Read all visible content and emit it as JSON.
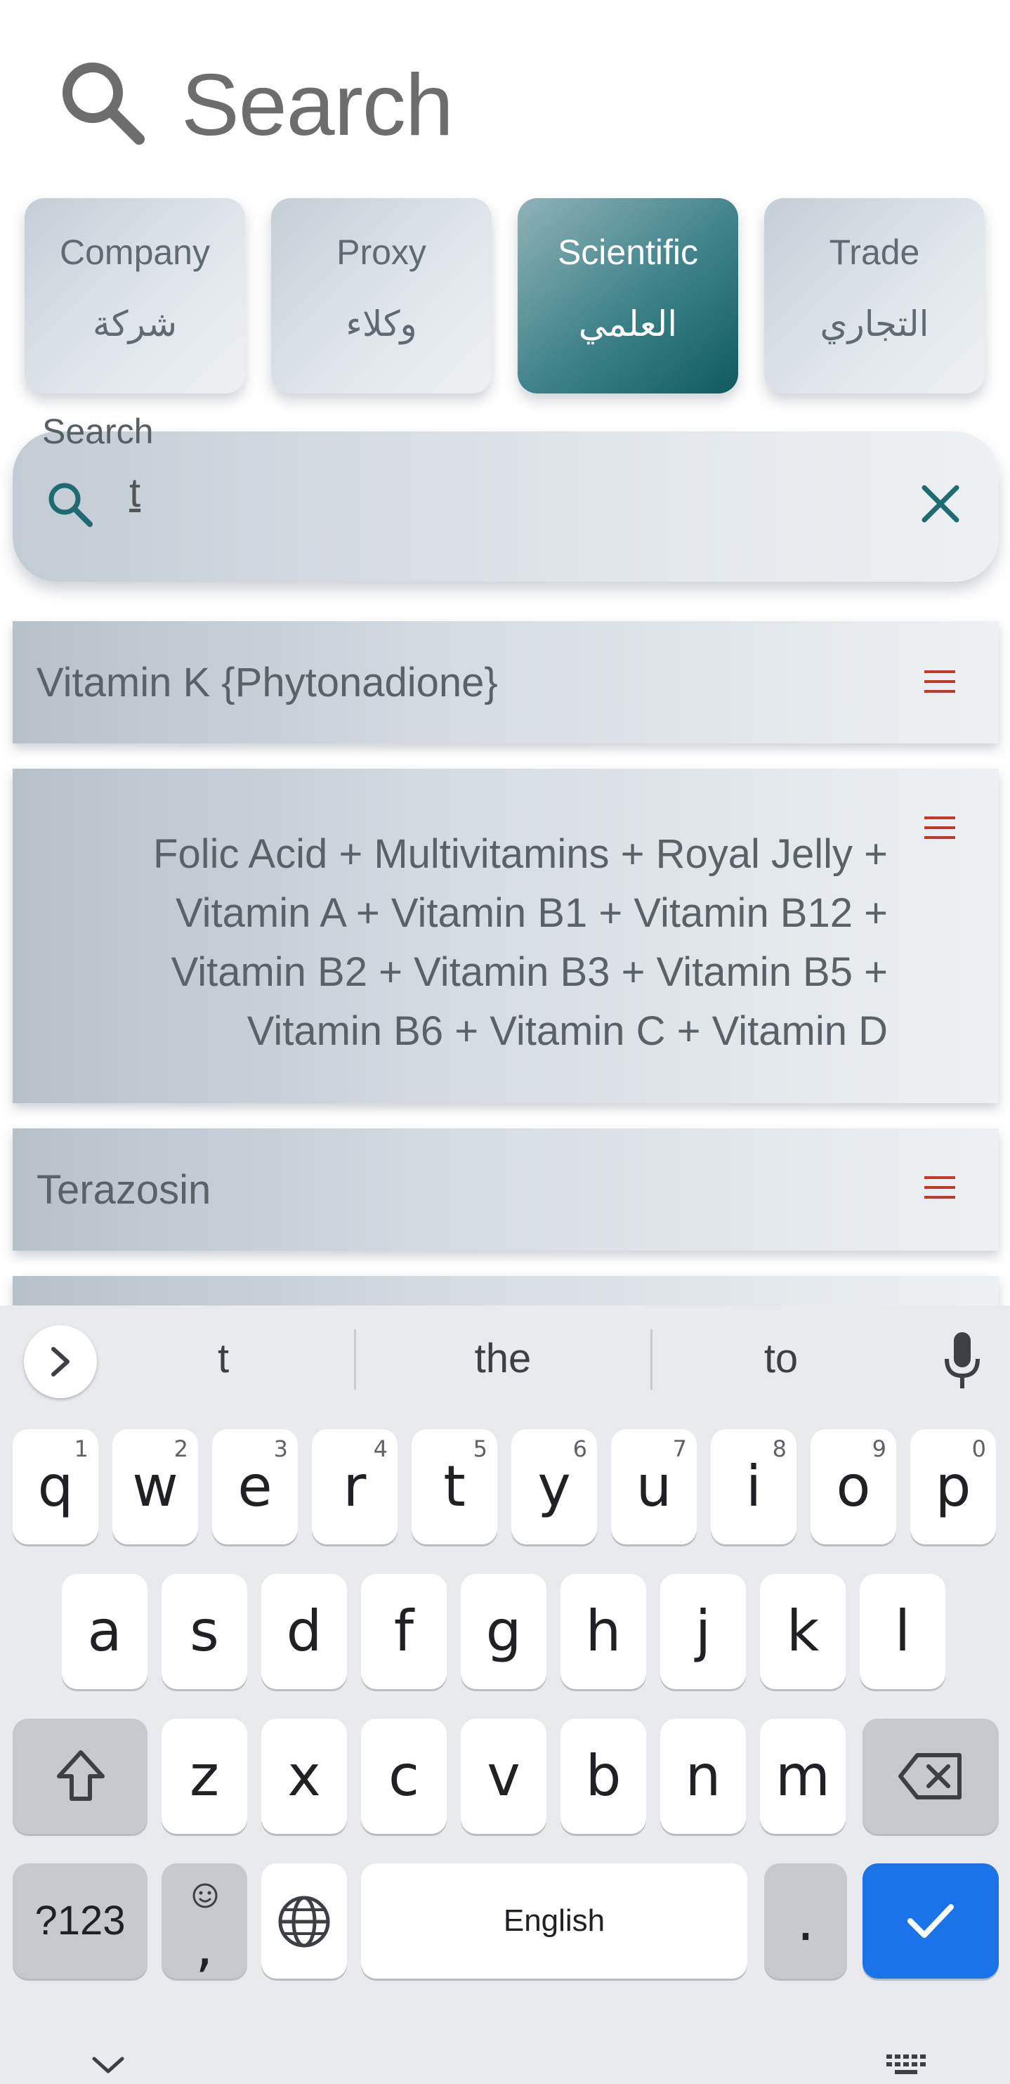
{
  "header": {
    "title": "Search",
    "icon": "search-icon"
  },
  "tabs": [
    {
      "en": "Company",
      "ar": "شركة",
      "active": false
    },
    {
      "en": "Proxy",
      "ar": "وكلاء",
      "active": false
    },
    {
      "en": "Scientific",
      "ar": "العلمي",
      "active": true
    },
    {
      "en": "Trade",
      "ar": "التجاري",
      "active": false
    }
  ],
  "search": {
    "label": "Search",
    "value": "t",
    "clear_icon": "close-icon"
  },
  "results": [
    {
      "title": "Vitamin K {Phytonadione}"
    },
    {
      "lines": [
        "Folic Acid + Multivitamins + Royal Jelly +",
        "Vitamin A + Vitamin B1 + Vitamin B12 +",
        "Vitamin B2 + Vitamin B3 + Vitamin B5 +",
        "Vitamin B6 + Vitamin C + Vitamin D"
      ]
    },
    {
      "title": "Terazosin"
    }
  ],
  "keyboard": {
    "suggestions": [
      "t",
      "the",
      "to"
    ],
    "row1": [
      {
        "k": "q",
        "h": "1"
      },
      {
        "k": "w",
        "h": "2"
      },
      {
        "k": "e",
        "h": "3"
      },
      {
        "k": "r",
        "h": "4"
      },
      {
        "k": "t",
        "h": "5"
      },
      {
        "k": "y",
        "h": "6"
      },
      {
        "k": "u",
        "h": "7"
      },
      {
        "k": "i",
        "h": "8"
      },
      {
        "k": "o",
        "h": "9"
      },
      {
        "k": "p",
        "h": "0"
      }
    ],
    "row2": [
      "a",
      "s",
      "d",
      "f",
      "g",
      "h",
      "j",
      "k",
      "l"
    ],
    "row3": [
      "z",
      "x",
      "c",
      "v",
      "b",
      "n",
      "m"
    ],
    "symbols_label": "?123",
    "emoji_comma": ",",
    "space_label": "English",
    "period_label": ".",
    "colors": {
      "accent": "#1a73e8",
      "tab_active": "#1f6b71",
      "menu_icon": "#c0392b"
    }
  }
}
